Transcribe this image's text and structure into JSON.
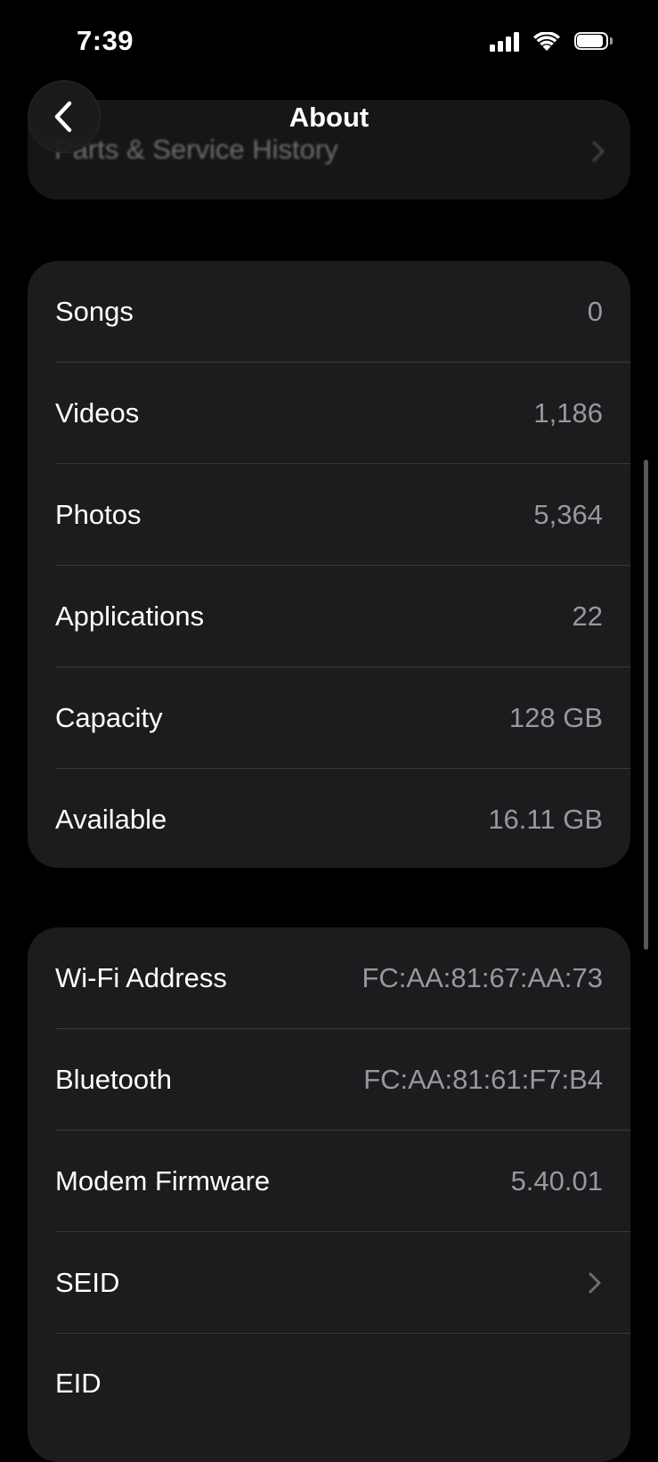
{
  "status_bar": {
    "time": "7:39",
    "icons": [
      "cellular-signal-icon",
      "wifi-icon",
      "battery-icon"
    ],
    "battery_level": 0.9
  },
  "nav": {
    "title": "About",
    "back_icon": "chevron-left-icon"
  },
  "previous_card": {
    "label": "Parts & Service History",
    "chevron_icon": "chevron-right-icon"
  },
  "stats": {
    "rows": [
      {
        "label": "Songs",
        "value": "0"
      },
      {
        "label": "Videos",
        "value": "1,186"
      },
      {
        "label": "Photos",
        "value": "5,364"
      },
      {
        "label": "Applications",
        "value": "22"
      },
      {
        "label": "Capacity",
        "value": "128 GB"
      },
      {
        "label": "Available",
        "value": "16.11 GB"
      }
    ]
  },
  "network": {
    "rows": [
      {
        "label": "Wi-Fi Address",
        "value": "FC:AA:81:67:AA:73"
      },
      {
        "label": "Bluetooth",
        "value": "FC:AA:81:61:F7:B4"
      },
      {
        "label": "Modem Firmware",
        "value": "5.40.01"
      },
      {
        "label": "SEID",
        "chevron_icon": "chevron-right-icon"
      }
    ],
    "eid": {
      "label": "EID"
    }
  },
  "colors": {
    "background": "#000000",
    "card": "#1c1c1e",
    "separator": "#3a3a3c",
    "secondary_text": "#98989d",
    "primary_text": "#ffffff"
  }
}
